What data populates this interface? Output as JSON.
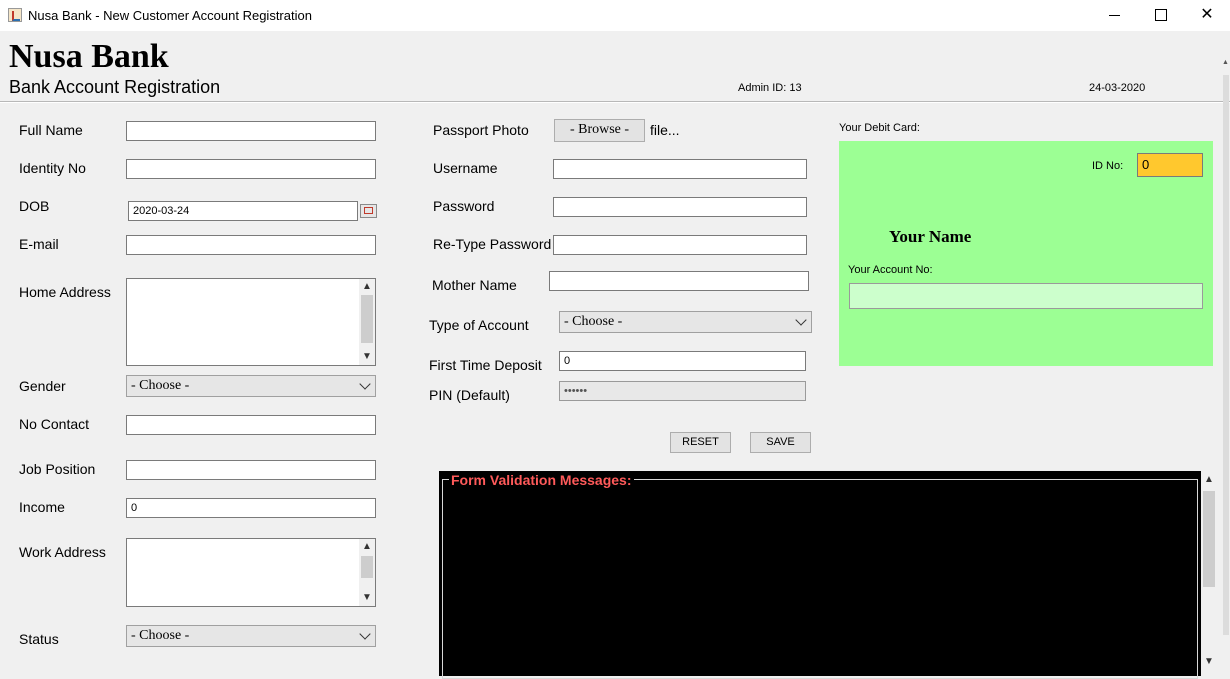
{
  "window": {
    "title": "Nusa Bank - New Customer Account Registration",
    "minimize": "—",
    "close": "✕"
  },
  "header": {
    "brand": "Nusa Bank",
    "subtitle": "Bank Account Registration",
    "admin": "Admin ID: 13",
    "date": "24-03-2020"
  },
  "left_form": {
    "full_name_label": "Full Name",
    "full_name_value": "",
    "identity_label": "Identity No",
    "identity_value": "",
    "dob_label": "DOB",
    "dob_value": "2020-03-24",
    "email_label": "E-mail",
    "email_value": "",
    "home_address_label": "Home Address",
    "gender_label": "Gender",
    "gender_value": "- Choose -",
    "contact_label": "No Contact",
    "contact_value": "",
    "job_label": "Job Position",
    "job_value": "",
    "income_label": "Income",
    "income_value": "0",
    "work_address_label": "Work Address",
    "status_label": "Status",
    "status_value": "- Choose -"
  },
  "middle_form": {
    "photo_label": "Passport Photo",
    "browse_label": "- Browse -",
    "file_text": "file...",
    "username_label": "Username",
    "password_label": "Password",
    "retype_label": "Re-Type Password",
    "mother_label": "Mother Name",
    "account_type_label": "Type of Account",
    "account_type_value": "- Choose -",
    "deposit_label": "First Time Deposit",
    "deposit_value": "0",
    "pin_label": "PIN (Default)",
    "pin_value": "••••••",
    "reset_label": "RESET",
    "save_label": "SAVE"
  },
  "card": {
    "caption": "Your Debit Card:",
    "id_label": "ID No:",
    "id_value": "0",
    "name": "Your Name",
    "account_label": "Your Account No:",
    "account_value": ""
  },
  "validation": {
    "title": "Form Validation Messages:"
  },
  "colors": {
    "card_bg": "#9cff94",
    "id_box": "#ffc82e",
    "account_box": "#ccffcc",
    "validation_title": "#ff5a5a"
  }
}
